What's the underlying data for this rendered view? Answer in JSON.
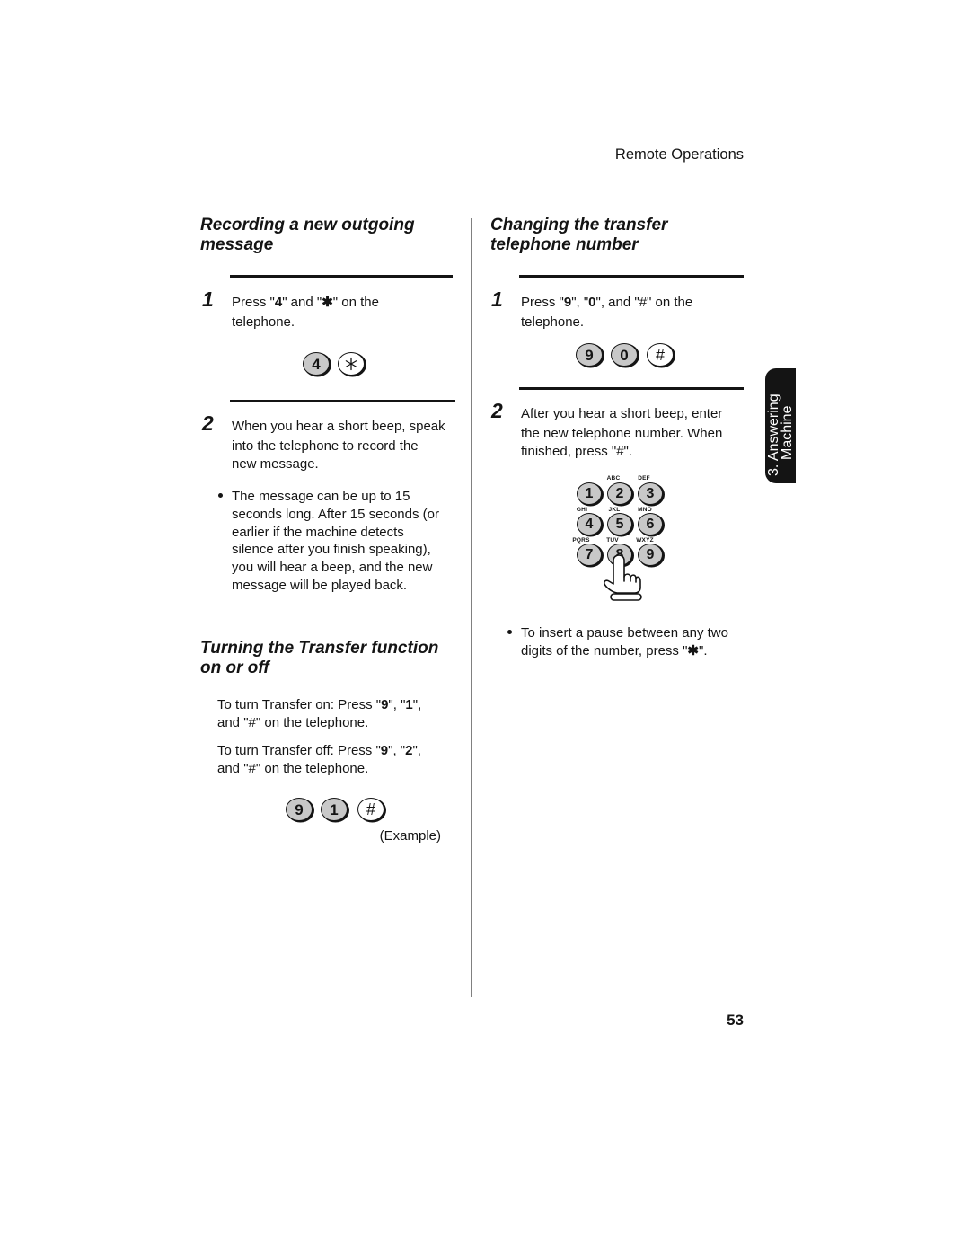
{
  "header": {
    "section_title": "Remote Operations"
  },
  "side_tab": {
    "number": "3.",
    "line1": "Answering",
    "line2": "Machine"
  },
  "page_number": "53",
  "recording": {
    "heading": [
      "Recording a new outgoing",
      "message"
    ],
    "step1": {
      "number": "1",
      "parts": [
        "Press \"",
        "4",
        "\" and \"",
        "✱",
        "\" on the",
        "telephone."
      ]
    },
    "step1_keys": [
      {
        "label": "4"
      },
      {
        "icon": "asterisk-icon"
      }
    ],
    "step2": {
      "number": "2",
      "lines": [
        "When you hear a short beep, speak",
        "into the telephone to record the",
        "new message."
      ]
    },
    "note": [
      "The message can be up to 15",
      "seconds long. After 15 seconds (or",
      "earlier if the machine detects",
      "silence after you finish speaking),",
      "you will hear a beep, and the new",
      "message will be played back."
    ]
  },
  "transfer_toggle": {
    "heading": [
      "Turning the Transfer function",
      "on or off"
    ],
    "on": [
      "To turn Transfer on: Press \"",
      "9",
      "\", \"",
      "1",
      "\",",
      "and \"#\" on the telephone."
    ],
    "off": [
      "To turn Transfer off: Press \"",
      "9",
      "\", \"",
      "2",
      "\",",
      "and \"#\" on the telephone."
    ],
    "keys": [
      {
        "label": "9"
      },
      {
        "label": "1"
      },
      {
        "label": "#"
      }
    ],
    "example_label": "(Example)"
  },
  "transfer_number": {
    "heading": [
      "Changing the transfer",
      "telephone number"
    ],
    "step1": {
      "number": "1",
      "parts": [
        "Press \"",
        "9",
        "\", \"",
        "0",
        "\", and \"#\" on the",
        "telephone."
      ]
    },
    "step1_keys": [
      {
        "label": "9"
      },
      {
        "label": "0"
      },
      {
        "label": "#"
      }
    ],
    "step2": {
      "number": "2",
      "lines": [
        "After you hear a short beep, enter",
        "the new telephone number. When",
        "finished, press \"#\"."
      ]
    },
    "keypad": [
      {
        "digit": "1",
        "letters": ""
      },
      {
        "digit": "2",
        "letters": "ABC"
      },
      {
        "digit": "3",
        "letters": "DEF"
      },
      {
        "digit": "4",
        "letters": "GHI"
      },
      {
        "digit": "5",
        "letters": "JKL"
      },
      {
        "digit": "6",
        "letters": "MNO"
      },
      {
        "digit": "7",
        "letters": "PQRS"
      },
      {
        "digit": "8",
        "letters": "TUV"
      },
      {
        "digit": "9",
        "letters": "WXYZ"
      }
    ],
    "keypad_icon": "pointing-hand-icon",
    "note": [
      "To insert a pause between any two",
      "digits of the number, press \"",
      "✱",
      "\"."
    ]
  }
}
